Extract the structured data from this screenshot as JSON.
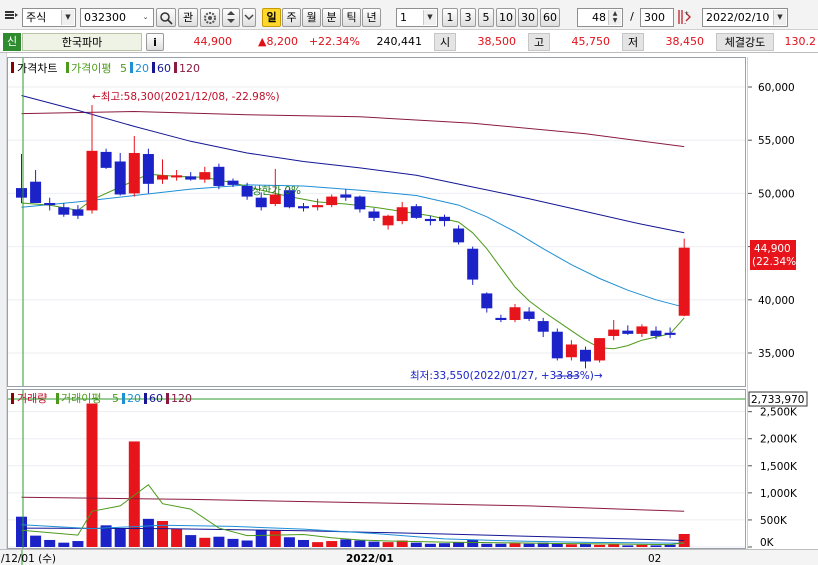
{
  "toolbar": {
    "menu_icon": "list-menu-icon",
    "market_type": "주식",
    "stock_code": "032300",
    "search_label": "🔍",
    "watch_label": "관",
    "periods": [
      "일",
      "주",
      "월",
      "분",
      "틱",
      "년"
    ],
    "active_period": "일",
    "interval_value": "1",
    "interval_options": [
      "1",
      "3",
      "5",
      "10",
      "30",
      "60"
    ],
    "display_count": "48",
    "count_separator": "/",
    "total_count": "300",
    "date": "2022/02/10"
  },
  "info": {
    "tag": "신",
    "stock_name": "한국파마",
    "info_button": "i",
    "price": "44,900",
    "change": "▲8,200",
    "change_rate": "+22.34%",
    "volume": "240,441",
    "open_label": "시",
    "open_value": "38,500",
    "high_label": "고",
    "high_value": "45,750",
    "low_label": "저",
    "low_value": "38,450",
    "strength_label": "체결강도",
    "strength_value": "130.2"
  },
  "legends": {
    "price_title": "가격차트",
    "price_ma_title": "가격이평",
    "volume_title": "거래량",
    "volume_ma_title": "거래이평",
    "ma_periods": [
      "5",
      "20",
      "60",
      "120"
    ]
  },
  "annotations": {
    "high": "←최고:58,300(2021/12/08, -22.98%)",
    "low": "최저:33,550(2022/01/27, +33.83%)→",
    "hidden": "상한가 0%",
    "current_price": "44,900",
    "current_rate": "(22.34%)",
    "current_volume": "2,733,970"
  },
  "x_labels": {
    "start": "/12/01 (수)",
    "month1": "2022/01",
    "month2": "02"
  },
  "colors": {
    "up": "#e8141c",
    "down": "#1a22c8",
    "ma5": "#4c9a1a",
    "ma20": "#1f8fd6",
    "ma60": "#141694",
    "ma120": "#8a1a40",
    "accent": "#ffd82b"
  },
  "chart_data": [
    {
      "type": "candlestick",
      "ylim": [
        32000,
        62000
      ],
      "yticks": [
        "60,000",
        "55,000",
        "50,000",
        "45,000",
        "40,000",
        "35,000"
      ],
      "ytick_values": [
        60000,
        55000,
        50000,
        45000,
        40000,
        35000
      ],
      "candles": [
        {
          "o": 50500,
          "h": 53700,
          "l": 49100,
          "c": 49600
        },
        {
          "o": 51100,
          "h": 52200,
          "l": 49100,
          "c": 49100
        },
        {
          "o": 49100,
          "h": 49600,
          "l": 48400,
          "c": 48900
        },
        {
          "o": 48700,
          "h": 49100,
          "l": 47800,
          "c": 48000
        },
        {
          "o": 48500,
          "h": 48900,
          "l": 47600,
          "c": 47900
        },
        {
          "o": 48400,
          "h": 58300,
          "l": 48100,
          "c": 54000
        },
        {
          "o": 53900,
          "h": 54200,
          "l": 52300,
          "c": 52400
        },
        {
          "o": 53000,
          "h": 53800,
          "l": 49800,
          "c": 49900
        },
        {
          "o": 50000,
          "h": 55400,
          "l": 49700,
          "c": 53800
        },
        {
          "o": 53700,
          "h": 54200,
          "l": 50000,
          "c": 50900
        },
        {
          "o": 51300,
          "h": 53200,
          "l": 50900,
          "c": 51700
        },
        {
          "o": 51500,
          "h": 52200,
          "l": 51200,
          "c": 51700
        },
        {
          "o": 51600,
          "h": 52000,
          "l": 51200,
          "c": 51300
        },
        {
          "o": 51300,
          "h": 52500,
          "l": 51000,
          "c": 52000
        },
        {
          "o": 52500,
          "h": 52800,
          "l": 50400,
          "c": 50700
        },
        {
          "o": 51200,
          "h": 51400,
          "l": 50600,
          "c": 50800
        },
        {
          "o": 50700,
          "h": 51000,
          "l": 49400,
          "c": 49700
        },
        {
          "o": 49600,
          "h": 50100,
          "l": 48400,
          "c": 48700
        },
        {
          "o": 49000,
          "h": 52300,
          "l": 48800,
          "c": 49900
        },
        {
          "o": 50300,
          "h": 50500,
          "l": 48600,
          "c": 48700
        },
        {
          "o": 48800,
          "h": 49100,
          "l": 48300,
          "c": 48600
        },
        {
          "o": 48700,
          "h": 49500,
          "l": 48400,
          "c": 48900
        },
        {
          "o": 48900,
          "h": 49900,
          "l": 48700,
          "c": 49700
        },
        {
          "o": 49900,
          "h": 50400,
          "l": 49300,
          "c": 49600
        },
        {
          "o": 49700,
          "h": 49800,
          "l": 48200,
          "c": 48500
        },
        {
          "o": 48300,
          "h": 48600,
          "l": 47400,
          "c": 47700
        },
        {
          "o": 47000,
          "h": 48000,
          "l": 46600,
          "c": 47900
        },
        {
          "o": 47400,
          "h": 49200,
          "l": 47100,
          "c": 48700
        },
        {
          "o": 48800,
          "h": 49000,
          "l": 47600,
          "c": 47700
        },
        {
          "o": 47600,
          "h": 47900,
          "l": 47000,
          "c": 47400
        },
        {
          "o": 47800,
          "h": 48000,
          "l": 46900,
          "c": 47400
        },
        {
          "o": 46700,
          "h": 47000,
          "l": 45200,
          "c": 45400
        },
        {
          "o": 44800,
          "h": 45000,
          "l": 41400,
          "c": 41900
        },
        {
          "o": 40600,
          "h": 40700,
          "l": 38800,
          "c": 39200
        },
        {
          "o": 38300,
          "h": 38600,
          "l": 37900,
          "c": 38100
        },
        {
          "o": 38100,
          "h": 39600,
          "l": 37900,
          "c": 39300
        },
        {
          "o": 38900,
          "h": 39300,
          "l": 38000,
          "c": 38200
        },
        {
          "o": 38000,
          "h": 38300,
          "l": 36500,
          "c": 37000
        },
        {
          "o": 37000,
          "h": 37300,
          "l": 34300,
          "c": 34500
        },
        {
          "o": 34600,
          "h": 36200,
          "l": 34300,
          "c": 35800
        },
        {
          "o": 35300,
          "h": 35600,
          "l": 33550,
          "c": 34200
        },
        {
          "o": 34300,
          "h": 36400,
          "l": 34100,
          "c": 36400
        },
        {
          "o": 36600,
          "h": 38100,
          "l": 36200,
          "c": 37200
        },
        {
          "o": 37100,
          "h": 37600,
          "l": 36700,
          "c": 36800
        },
        {
          "o": 36800,
          "h": 37700,
          "l": 36500,
          "c": 37500
        },
        {
          "o": 37100,
          "h": 37500,
          "l": 36300,
          "c": 36600
        },
        {
          "o": 36900,
          "h": 37400,
          "l": 36400,
          "c": 36700
        },
        {
          "o": 38500,
          "h": 45750,
          "l": 38450,
          "c": 44900
        }
      ],
      "ma": {
        "ma5": [
          [
            0,
            49100
          ],
          [
            2,
            48900
          ],
          [
            4,
            48400
          ],
          [
            5,
            49400
          ],
          [
            7,
            50600
          ],
          [
            9,
            51800
          ],
          [
            11,
            51600
          ],
          [
            13,
            51500
          ],
          [
            15,
            51000
          ],
          [
            17,
            50300
          ],
          [
            19,
            49700
          ],
          [
            21,
            49200
          ],
          [
            23,
            49000
          ],
          [
            25,
            48700
          ],
          [
            27,
            48300
          ],
          [
            29,
            47900
          ],
          [
            31,
            47300
          ],
          [
            32,
            46300
          ],
          [
            33,
            44800
          ],
          [
            34,
            43000
          ],
          [
            35,
            41200
          ],
          [
            36,
            39900
          ],
          [
            37,
            38900
          ],
          [
            38,
            38000
          ],
          [
            39,
            37100
          ],
          [
            40,
            36200
          ],
          [
            41,
            35500
          ],
          [
            42,
            35400
          ],
          [
            43,
            35700
          ],
          [
            44,
            36200
          ],
          [
            45,
            36500
          ],
          [
            46,
            36800
          ],
          [
            47,
            38300
          ]
        ],
        "ma20": [
          [
            0,
            48700
          ],
          [
            4,
            49200
          ],
          [
            8,
            49800
          ],
          [
            12,
            50400
          ],
          [
            16,
            50800
          ],
          [
            20,
            50700
          ],
          [
            24,
            50300
          ],
          [
            28,
            49800
          ],
          [
            31,
            48900
          ],
          [
            33,
            47800
          ],
          [
            35,
            46400
          ],
          [
            37,
            44800
          ],
          [
            39,
            43300
          ],
          [
            41,
            42000
          ],
          [
            43,
            40900
          ],
          [
            45,
            40000
          ],
          [
            47,
            39300
          ]
        ],
        "ma60": [
          [
            0,
            59200
          ],
          [
            4,
            57800
          ],
          [
            8,
            56300
          ],
          [
            12,
            54900
          ],
          [
            16,
            53800
          ],
          [
            20,
            53000
          ],
          [
            24,
            52400
          ],
          [
            28,
            51700
          ],
          [
            32,
            50600
          ],
          [
            36,
            49500
          ],
          [
            40,
            48300
          ],
          [
            44,
            47100
          ],
          [
            47,
            46300
          ]
        ],
        "ma120": [
          [
            0,
            57500
          ],
          [
            8,
            57700
          ],
          [
            16,
            57400
          ],
          [
            24,
            57200
          ],
          [
            32,
            56600
          ],
          [
            40,
            55600
          ],
          [
            47,
            54400
          ]
        ]
      }
    },
    {
      "type": "bar",
      "name": "거래량",
      "ylim": [
        0,
        2733970
      ],
      "yticks": [
        "2,500K",
        "2,000K",
        "1,500K",
        "1,000K",
        "500K",
        "0K"
      ],
      "ytick_values": [
        2500000,
        2000000,
        1500000,
        1000000,
        500000,
        0
      ],
      "values": [
        560000,
        210000,
        130000,
        80000,
        110000,
        2650000,
        400000,
        340000,
        1950000,
        520000,
        480000,
        330000,
        220000,
        170000,
        190000,
        150000,
        120000,
        320000,
        310000,
        180000,
        130000,
        90000,
        110000,
        140000,
        120000,
        100000,
        90000,
        120000,
        80000,
        60000,
        70000,
        90000,
        130000,
        60000,
        60000,
        70000,
        60000,
        80000,
        60000,
        50000,
        60000,
        40000,
        50000,
        30000,
        40000,
        30000,
        40000,
        240441
      ],
      "ma": {
        "ma5": [
          [
            0,
            310000
          ],
          [
            4,
            220000
          ],
          [
            5,
            660000
          ],
          [
            7,
            760000
          ],
          [
            9,
            1150000
          ],
          [
            10,
            800000
          ],
          [
            12,
            700000
          ],
          [
            14,
            350000
          ],
          [
            16,
            210000
          ],
          [
            18,
            220000
          ],
          [
            20,
            230000
          ],
          [
            22,
            170000
          ],
          [
            24,
            130000
          ],
          [
            26,
            110000
          ],
          [
            30,
            90000
          ],
          [
            34,
            80000
          ],
          [
            38,
            65000
          ],
          [
            42,
            55000
          ],
          [
            46,
            45000
          ],
          [
            47,
            80000
          ]
        ],
        "ma20": [
          [
            0,
            410000
          ],
          [
            5,
            340000
          ],
          [
            10,
            400000
          ],
          [
            15,
            380000
          ],
          [
            20,
            330000
          ],
          [
            25,
            250000
          ],
          [
            30,
            150000
          ],
          [
            35,
            110000
          ],
          [
            40,
            85000
          ],
          [
            47,
            70000
          ]
        ],
        "ma60": [
          [
            0,
            350000
          ],
          [
            10,
            340000
          ],
          [
            20,
            300000
          ],
          [
            30,
            240000
          ],
          [
            40,
            170000
          ],
          [
            47,
            120000
          ]
        ],
        "ma120": [
          [
            0,
            920000
          ],
          [
            12,
            880000
          ],
          [
            24,
            820000
          ],
          [
            36,
            760000
          ],
          [
            47,
            660000
          ]
        ]
      }
    }
  ]
}
